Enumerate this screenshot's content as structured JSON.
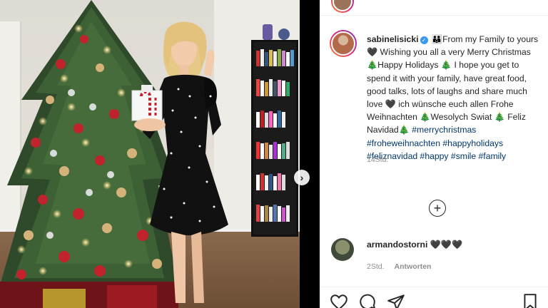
{
  "post": {
    "username": "sabinelisicki",
    "verified_symbol": "✓",
    "caption_segments": [
      "👪From my Family to yours🖤 Wishing you all a very Merry Christmas 🎄Happy Holidays 🎄 I hope you get to spend it with your family, have great food, good talks, lots of laughs and share much love 🖤 ich wünsche euch allen Frohe Weihnachten 🎄Wesolych Swiat 🎄 Feliz Navidad🎄 "
    ],
    "hashtags": [
      "#merrychristmas",
      "#froheweihnachten",
      "#happyholidays",
      "#feliznavidad",
      "#happy",
      "#smile",
      "#family"
    ],
    "time": "14Std.",
    "more_symbol": "+"
  },
  "comment": {
    "username": "armandostorni",
    "text": "🖤🖤🖤",
    "time": "2Std.",
    "reply_label": "Antworten"
  },
  "media": {
    "next_symbol": "›"
  },
  "icons": {
    "like": "heart-icon",
    "comment": "comment-icon",
    "share": "share-icon",
    "save": "bookmark-icon"
  },
  "colors": {
    "link": "#00376b",
    "verified": "#3897f0",
    "text": "#262626",
    "muted": "#8e8e8e"
  }
}
